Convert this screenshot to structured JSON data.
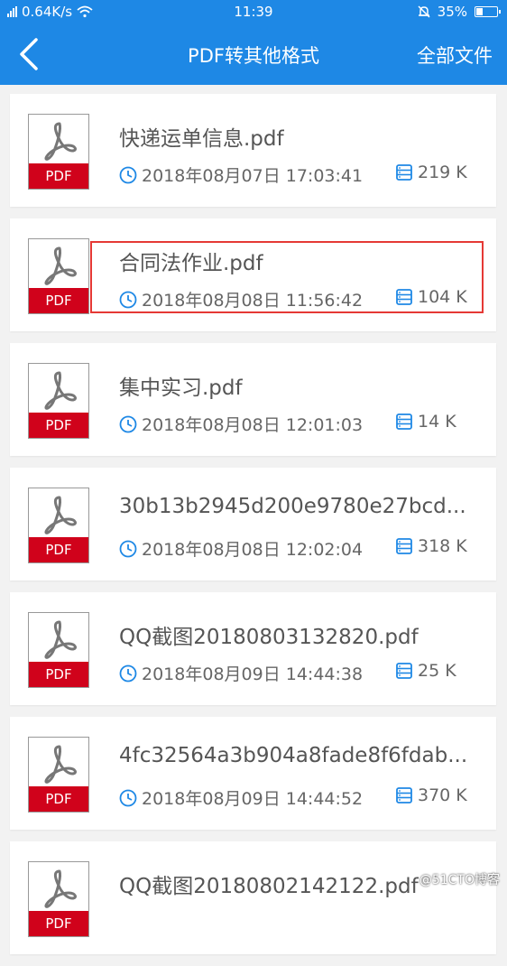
{
  "status": {
    "network": "0.64K/s",
    "time": "11:39",
    "battery": "35%"
  },
  "header": {
    "title": "PDF转其他格式",
    "right_action": "全部文件"
  },
  "files": [
    {
      "name": "快递运单信息.pdf",
      "date": "2018年08月07日 17:03:41",
      "size": "219 K",
      "icon_label": "PDF"
    },
    {
      "name": "合同法作业.pdf",
      "date": "2018年08月08日 11:56:42",
      "size": "104 K",
      "icon_label": "PDF",
      "highlighted": true
    },
    {
      "name": "集中实习.pdf",
      "date": "2018年08月08日 12:01:03",
      "size": "14 K",
      "icon_label": "PDF"
    },
    {
      "name": "30b13b2945d200e9780e27bcd...",
      "date": "2018年08月08日 12:02:04",
      "size": "318 K",
      "icon_label": "PDF"
    },
    {
      "name": "QQ截图20180803132820.pdf",
      "date": "2018年08月09日 14:44:38",
      "size": "25 K",
      "icon_label": "PDF"
    },
    {
      "name": "4fc32564a3b904a8fade8f6fdab...",
      "date": "2018年08月09日 14:44:52",
      "size": "370 K",
      "icon_label": "PDF"
    },
    {
      "name": "QQ截图20180802142122.pdf",
      "date": "",
      "size": "",
      "icon_label": "PDF"
    }
  ],
  "watermark": "@51CTO博客",
  "colors": {
    "header_bg": "#1e88e5",
    "icon_accent": "#1e88e5",
    "pdf_band": "#d0021b",
    "highlight": "#e53935"
  }
}
